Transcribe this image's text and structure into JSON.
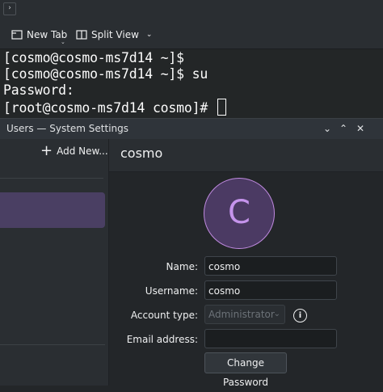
{
  "konsole": {
    "toolbar": {
      "new_tab_label": "New Tab",
      "split_view_label": "Split View"
    },
    "terminal_lines": [
      "[cosmo@cosmo-ms7d14 ~]$",
      "[cosmo@cosmo-ms7d14 ~]$ su",
      "Password:",
      "[root@cosmo-ms7d14 cosmo]# "
    ]
  },
  "settings_window": {
    "title": "Users — System Settings",
    "add_new_label": "Add New...",
    "selected_user": "cosmo",
    "avatar_initial": "C",
    "form": {
      "name_label": "Name:",
      "name_value": "cosmo",
      "username_label": "Username:",
      "username_value": "cosmo",
      "account_type_label": "Account type:",
      "account_type_value": "Administrator",
      "email_label": "Email address:",
      "email_value": "",
      "change_password_label": "Change Password"
    }
  },
  "colors": {
    "accent": "#c08ae0",
    "selection": "#4a3f63",
    "terminal_bg": "#232627"
  }
}
